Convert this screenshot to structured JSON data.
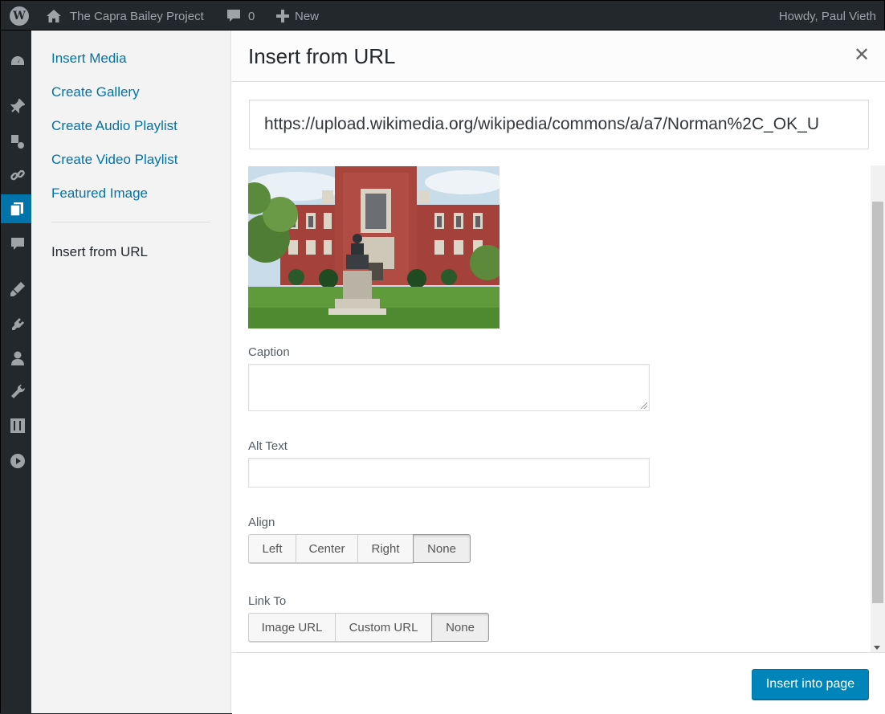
{
  "adminbar": {
    "wp_logo": "W",
    "wp_icon": "wordpress-logo-icon",
    "site_icon": "home-icon",
    "site_title": "The Capra Bailey Project",
    "comments_icon": "comment-bubble-icon",
    "comments_count": "0",
    "new_icon": "plus-icon",
    "new_label": "New",
    "howdy": "Howdy, Paul Vieth"
  },
  "adminmenu": {
    "icons": [
      "dashboard-icon",
      "pin-icon",
      "media-icon",
      "links-icon",
      "pages-icon",
      "comments-icon",
      "appearance-icon",
      "plugins-icon",
      "users-icon",
      "tools-icon",
      "settings-icon",
      "play-icon"
    ],
    "active": "pages-icon"
  },
  "media_menu": {
    "items": [
      "Insert Media",
      "Create Gallery",
      "Create Audio Playlist",
      "Create Video Playlist",
      "Featured Image"
    ],
    "current": "Insert from URL"
  },
  "frame": {
    "title": "Insert from URL",
    "close_icon": "close-icon",
    "close_glyph": "✕"
  },
  "embed": {
    "url": "https://upload.wikimedia.org/wikipedia/commons/a/a7/Norman%2C_OK_U",
    "caption_label": "Caption",
    "caption_value": "",
    "alt_label": "Alt Text",
    "alt_value": "",
    "align_label": "Align",
    "align_options": [
      "Left",
      "Center",
      "Right",
      "None"
    ],
    "align_selected": "None",
    "link_label": "Link To",
    "link_options": [
      "Image URL",
      "Custom URL",
      "None"
    ],
    "link_selected": "None"
  },
  "toolbar": {
    "insert_label": "Insert into page"
  },
  "colors": {
    "accent": "#0073aa",
    "primary_button": "#0085ba",
    "adminbar": "#23282d"
  }
}
